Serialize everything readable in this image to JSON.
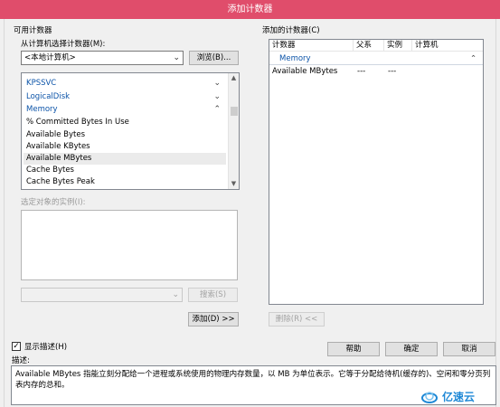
{
  "window": {
    "title": "添加计数器"
  },
  "available": {
    "section_label": "可用计数器",
    "computer_label": "从计算机选择计数器(M):",
    "computer_value": "<本地计算机>",
    "browse_button": "浏览(B)...",
    "objects": [
      {
        "name": "KPSSVC",
        "expanded": false
      },
      {
        "name": "LogicalDisk",
        "expanded": false
      },
      {
        "name": "Memory",
        "expanded": true
      }
    ],
    "counters": [
      {
        "name": "% Committed Bytes In Use",
        "selected": false
      },
      {
        "name": "Available Bytes",
        "selected": false
      },
      {
        "name": "Available KBytes",
        "selected": false
      },
      {
        "name": "Available MBytes",
        "selected": true
      },
      {
        "name": "Cache Bytes",
        "selected": false
      },
      {
        "name": "Cache Bytes Peak",
        "selected": false
      }
    ],
    "instances_label": "选定对象的实例(I):",
    "search_button": "搜索(S)",
    "add_button": "添加(D) >>"
  },
  "added": {
    "section_label": "添加的计数器(C)",
    "columns": [
      "计数器",
      "父系",
      "实例",
      "计算机"
    ],
    "group": "Memory",
    "rows": [
      {
        "counter": "Available MBytes",
        "parent": "---",
        "instance": "---",
        "computer": ""
      }
    ],
    "remove_button": "删除(R) <<"
  },
  "footer": {
    "show_description_label": "显示描述(H)",
    "show_description_checked": true,
    "help_button": "帮助",
    "ok_button": "确定",
    "cancel_button": "取消",
    "description_label": "描述:",
    "description_text": "Available MBytes 指能立刻分配给一个进程或系统使用的物理内存数量，以 MB 为单位表示。它等于分配给待机(缓存的)、空闲和零分页列表内存的总和。"
  },
  "watermark": {
    "text": "亿速云"
  },
  "colors": {
    "title_bar": "#e04d6b",
    "object_text": "#0b53a8",
    "logo_blue": "#1e88d6"
  }
}
